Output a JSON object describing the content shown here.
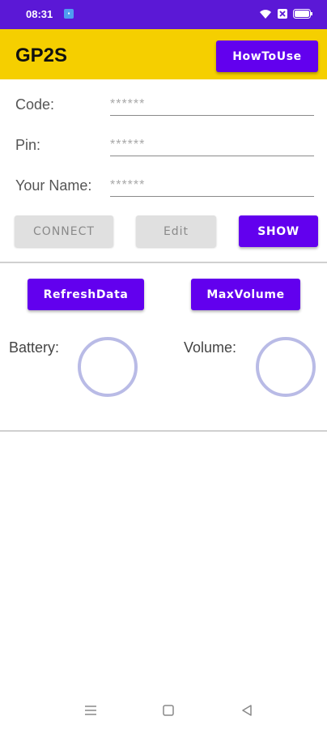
{
  "status_bar": {
    "time": "08:31"
  },
  "app_bar": {
    "title": "GP2S",
    "how_to_use_label": "HowToUse"
  },
  "form": {
    "code": {
      "label": "Code:",
      "placeholder": "******"
    },
    "pin": {
      "label": "Pin:",
      "placeholder": "******"
    },
    "name": {
      "label": "Your Name:",
      "placeholder": "******"
    }
  },
  "actions": {
    "connect_label": "CONNECT",
    "edit_label": "Edit",
    "show_label": "SHOW"
  },
  "controls": {
    "refresh_label": "RefreshData",
    "max_volume_label": "MaxVolume"
  },
  "metrics": {
    "battery_label": "Battery:",
    "volume_label": "Volume:"
  },
  "colors": {
    "status_bar": "#5b18d6",
    "app_bar": "#f5cf00",
    "accent": "#6200ee",
    "gauge_ring": "#b9bbe6"
  },
  "icons": {
    "nav": [
      "menu-icon",
      "home-icon",
      "back-icon"
    ]
  }
}
